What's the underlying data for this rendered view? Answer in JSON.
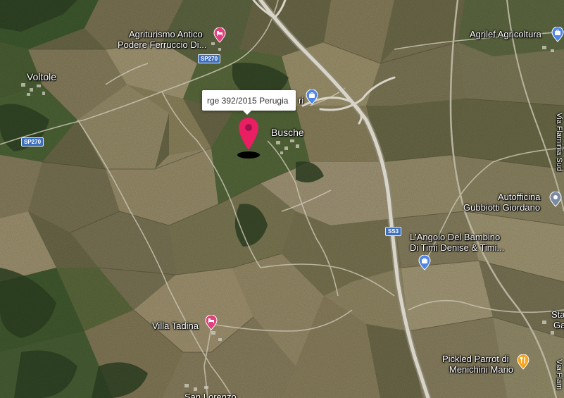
{
  "map": {
    "tooltip_text": "rge 392/2015 Perugia",
    "places": {
      "voltole": "Voltole",
      "busche": "Busche",
      "villa_tadina": "Villa Tadina",
      "san_lorenzo": "San Lorenzo",
      "agriturismo_line1": "Agriturismo Antico",
      "agriturismo_line2": "Podere Ferruccio Di...",
      "agrilef": "Agrilef Agricoltura",
      "autofficina_line1": "Autofficina",
      "autofficina_line2": "Gubbiotti Giordano",
      "angolo_line1": "L'Angolo Del Bambino",
      "angolo_line2": "Di Timi Denise & Timi...",
      "pickled_line1": "Pickled Parrot di",
      "pickled_line2": "Menichini Mario",
      "ri_fragment": "ri",
      "sta_fragment_1": "Sta",
      "sta_fragment_2": "Ga",
      "via_flaminia_sud": "Via Flaminia Sud",
      "via_flaminia_2": "Via Flam"
    },
    "road_shields": {
      "sp270_top": "SP270",
      "sp270_left": "SP270",
      "ss3": "SS3"
    },
    "icons": {
      "hotel": "bed-icon",
      "shopping": "shopping-bag-icon",
      "service": "map-marker-icon",
      "food": "fork-knife-icon",
      "pin": "map-pin-icon"
    },
    "colors": {
      "pin": "#e91e63",
      "hotel_poi": "#e0407b",
      "shopping_poi": "#4f86e6",
      "service_poi": "#7b8aa0",
      "food_poi": "#f4a522"
    }
  }
}
